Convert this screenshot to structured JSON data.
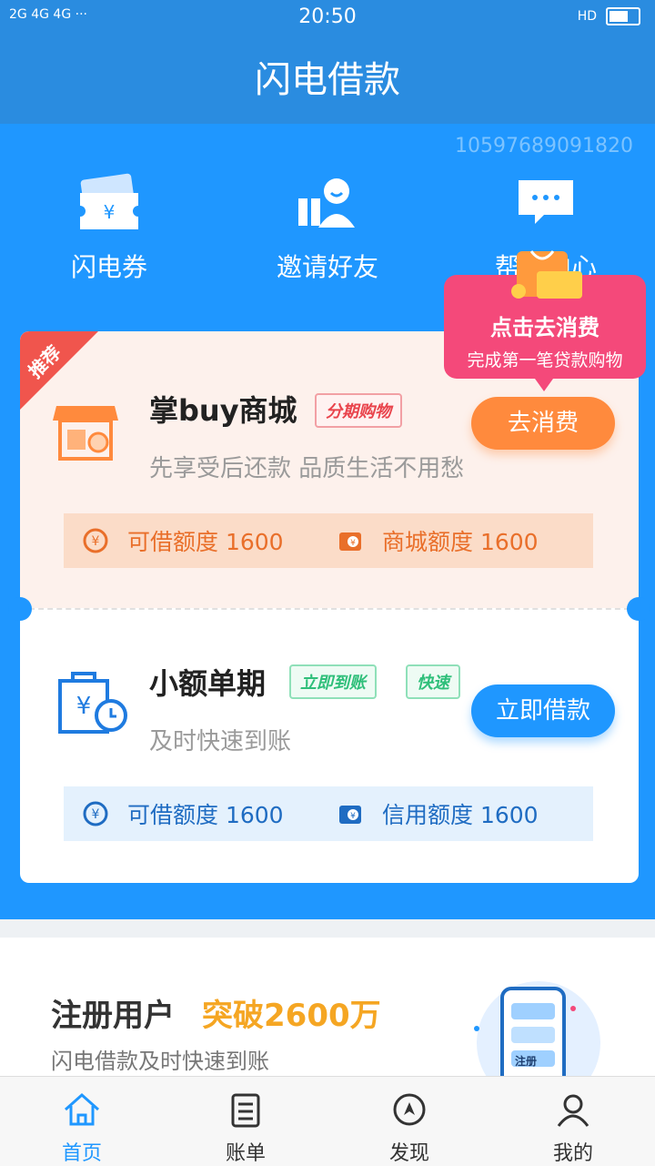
{
  "status": {
    "time": "20:50",
    "signal": "2G 4G 4G ···",
    "hd": "HD"
  },
  "header": {
    "title": "闪电借款"
  },
  "user_id": "10597689091820",
  "quick_actions": [
    {
      "label": "闪电券",
      "icon": "coupon-icon"
    },
    {
      "label": "邀请好友",
      "icon": "invite-friend-icon"
    },
    {
      "label": "帮助中心",
      "icon": "chat-bubble-icon"
    }
  ],
  "tooltip": {
    "title": "点击去消费",
    "desc": "完成第一笔贷款购物"
  },
  "products": [
    {
      "ribbon": "推荐",
      "title": "掌buy商城",
      "tags": [
        "分期购物"
      ],
      "subtitle": "先享受后还款 品质生活不用愁",
      "cta": "去消费",
      "quota": [
        {
          "label": "可借额度 1600"
        },
        {
          "label": "商城额度 1600"
        }
      ]
    },
    {
      "title": "小额单期",
      "tags": [
        "立即到账",
        "快速"
      ],
      "subtitle": "及时快速到账",
      "cta": "立即借款",
      "quota": [
        {
          "label": "可借额度 1600"
        },
        {
          "label": "信用额度 1600"
        }
      ]
    }
  ],
  "promo": {
    "title": "注册用户",
    "highlight": "突破2600万",
    "subtitle": "闪电借款及时快速到账",
    "phone_label": "注册"
  },
  "nav": [
    {
      "label": "首页",
      "active": true
    },
    {
      "label": "账单",
      "active": false
    },
    {
      "label": "发现",
      "active": false
    },
    {
      "label": "我的",
      "active": false
    }
  ],
  "colors": {
    "primary": "#1f97ff",
    "header": "#2a8ce0",
    "orange": "#ff8a3d",
    "pink": "#f4497a",
    "green": "#2fbf7a"
  }
}
